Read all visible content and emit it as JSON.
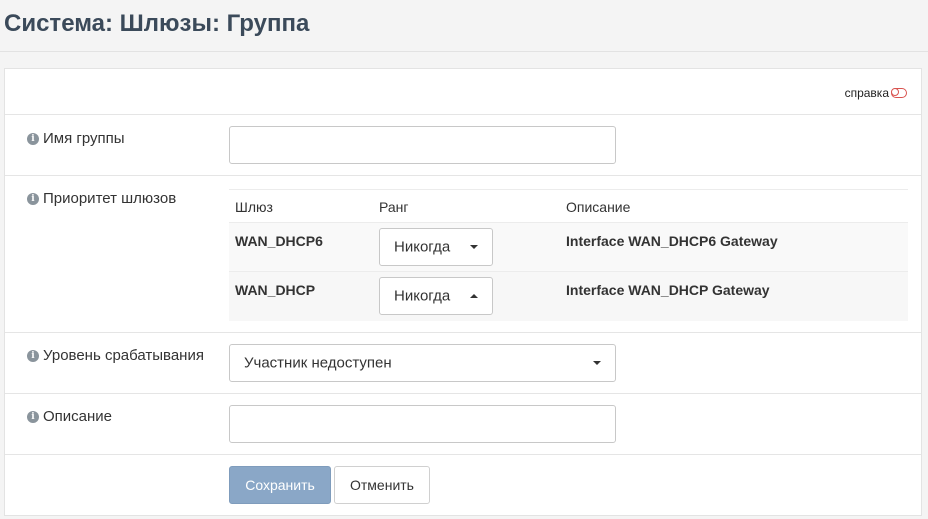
{
  "header": {
    "title": "Система: Шлюзы: Группа"
  },
  "help": {
    "label": "справка"
  },
  "group_name": {
    "label": "Имя группы",
    "value": ""
  },
  "priority": {
    "label": "Приоритет шлюзов",
    "columns": {
      "gateway": "Шлюз",
      "tier": "Ранг",
      "description": "Описание"
    },
    "rows": [
      {
        "gateway": "WAN_DHCP6",
        "tier": "Никогда",
        "description": "Interface WAN_DHCP6 Gateway"
      },
      {
        "gateway": "WAN_DHCP",
        "tier": "Никогда",
        "description": "Interface WAN_DHCP Gateway"
      }
    ]
  },
  "trigger": {
    "label": "Уровень срабатывания",
    "value": "Участник недоступен"
  },
  "description": {
    "label": "Описание",
    "value": ""
  },
  "actions": {
    "save": "Сохранить",
    "cancel": "Отменить"
  },
  "icons": {
    "info": "info-circle-icon",
    "help_toggle": "toggle-off-icon"
  },
  "colors": {
    "title": "#3b4a5a",
    "primary_button": "#8aa7c7",
    "help_toggle": "#d9534f"
  }
}
